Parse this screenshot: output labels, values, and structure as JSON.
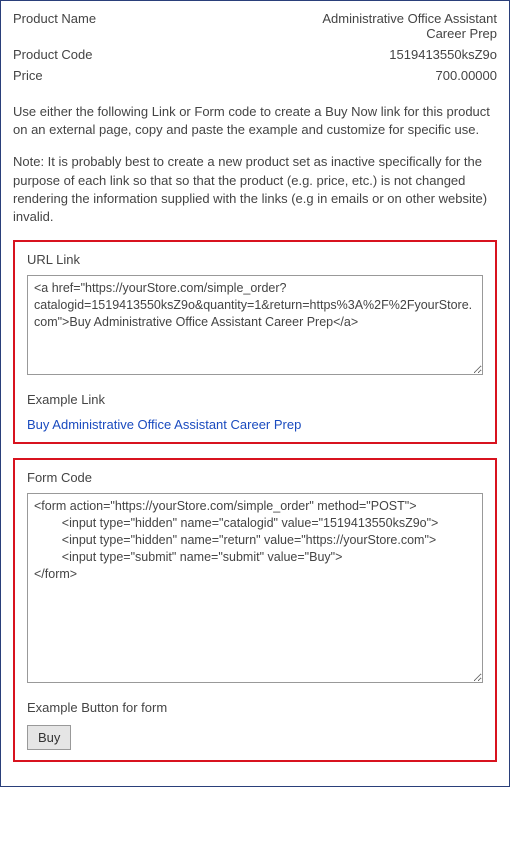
{
  "product": {
    "name_label": "Product Name",
    "name_value": "Administrative Office Assistant Career Prep",
    "code_label": "Product Code",
    "code_value": "1519413550ksZ9o",
    "price_label": "Price",
    "price_value": "700.00000"
  },
  "instructions": {
    "paragraph1": "Use either the following Link or Form code to create a Buy Now link for this product on an external page, copy and paste the example and customize for specific use.",
    "paragraph2": "Note: It is probably best to create a new product set as inactive specifically for the purpose of each link so that so that the product (e.g. price, etc.) is not changed rendering the information supplied with the links (e.g in emails or on other website) invalid."
  },
  "url_section": {
    "title": "URL Link",
    "code": "<a href=\"https://yourStore.com/simple_order?catalogid=1519413550ksZ9o&quantity=1&return=https%3A%2F%2FyourStore.com\">Buy Administrative Office Assistant Career Prep</a>",
    "example_label": "Example Link",
    "example_link_text": "Buy Administrative Office Assistant Career Prep"
  },
  "form_section": {
    "title": "Form Code",
    "code": "<form action=\"https://yourStore.com/simple_order\" method=\"POST\">\n        <input type=\"hidden\" name=\"catalogid\" value=\"1519413550ksZ9o\">\n        <input type=\"hidden\" name=\"return\" value=\"https://yourStore.com\">\n        <input type=\"submit\" name=\"submit\" value=\"Buy\">\n</form>",
    "example_label": "Example Button for form",
    "button_label": "Buy"
  }
}
